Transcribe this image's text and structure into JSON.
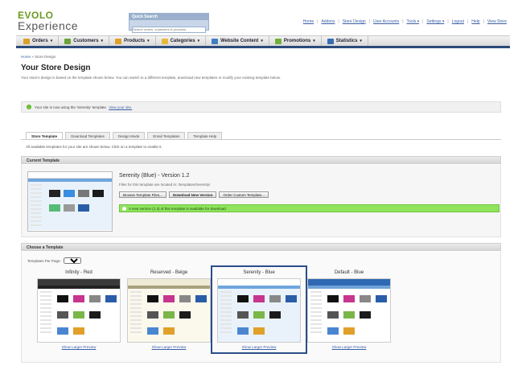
{
  "brand": {
    "line1": "EVOLO",
    "line2": "Experience",
    "color": "#6a9a1f"
  },
  "search": {
    "label": "Quick Search",
    "placeholder": "Search orders, customers & products"
  },
  "top_links": [
    "Home",
    "Addons",
    "Store Design",
    "User Accounts",
    "Tools ▾",
    "Settings ▾",
    "Logout",
    "Help",
    "View Store"
  ],
  "menu": [
    {
      "label": "Orders",
      "icon": "orders-icon",
      "color": "#d9a126"
    },
    {
      "label": "Customers",
      "icon": "customers-icon",
      "color": "#6aa33a"
    },
    {
      "label": "Products",
      "icon": "products-icon",
      "color": "#e0a02a"
    },
    {
      "label": "Categories",
      "icon": "categories-icon",
      "color": "#e7b93b"
    },
    {
      "label": "Website Content",
      "icon": "website-content-icon",
      "color": "#3f7fc2"
    },
    {
      "label": "Promotions",
      "icon": "promotions-icon",
      "color": "#72b03a"
    },
    {
      "label": "Statistics",
      "icon": "statistics-icon",
      "color": "#3b6db3"
    }
  ],
  "breadcrumb": {
    "home": "Home",
    "sep": "»",
    "current": "Store Design"
  },
  "page": {
    "title": "Your Store Design",
    "description": "Your store's design is based on the template shown below. You can switch to a different template, download new templates or modify your existing template below."
  },
  "notice": {
    "text": "Your site is now using the 'Serenity' template.",
    "link": "View your site."
  },
  "tabs": [
    "Store Template",
    "Download Templates",
    "Design Mode",
    "Email Templates",
    "Template Help"
  ],
  "tab_note": "All available templates for your site are shown below. Click on a template to enable it.",
  "current_template": {
    "heading": "Current Template",
    "name": "Serenity (Blue) - Version 1.2",
    "files": "Files for this template are located in: /templates/Serenity/",
    "buttons": [
      "Browse Template Files...",
      "Download New Version",
      "Order Custom Template..."
    ],
    "update": "A new version (1.3) of this template is available for download"
  },
  "choose": {
    "heading": "Choose a Template",
    "per_page_label": "Templates Per Page:",
    "per_page_value": "20",
    "preview_label": "Show Larger Preview",
    "templates": [
      {
        "name": "Infinity - Red",
        "head": "#3a3a3a",
        "nav": "#222",
        "body": "#ffffff",
        "selected": false
      },
      {
        "name": "Reserved - Beige",
        "head": "#f0ebd5",
        "nav": "#a7a27e",
        "body": "#fbf8ec",
        "selected": false
      },
      {
        "name": "Serenity - Blue",
        "head": "#ffffff",
        "nav": "#6fa6dd",
        "body": "#e9f2fb",
        "selected": true
      },
      {
        "name": "Default - Blue",
        "head": "#2f69b3",
        "nav": "#6fa3d8",
        "body": "#ffffff",
        "selected": false
      }
    ]
  }
}
